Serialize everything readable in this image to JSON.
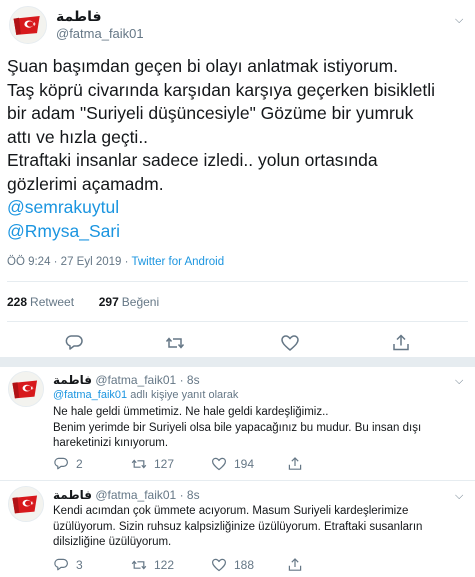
{
  "main_tweet": {
    "author_name": "فاطمة",
    "author_handle": "@fatma_faik01",
    "text_lines": [
      "Şuan başımdan geçen bi olayı anlatmak istiyorum.",
      "Taş köprü civarında karşıdan karşıya geçerken bisikletli",
      "bir adam \"Suriyeli düşüncesiyle\" Gözüme bir yumruk",
      "attı ve hızla geçti..",
      "Etraftaki insanlar sadece izledi.. yolun ortasında",
      "gözlerimi açamadm."
    ],
    "mentions": [
      "@semrakuytul",
      "@Rmysa_Sari"
    ],
    "time": "ÖÖ 9:24 · 27 Eyl 2019 · ",
    "source": "Twitter for Android",
    "retweets_count": "228",
    "retweets_label": "Retweet",
    "likes_count": "297",
    "likes_label": "Beğeni"
  },
  "replies": [
    {
      "author_name": "فاطمة",
      "author_handle": "@fatma_faik01 · 8s",
      "replying_to": "@fatma_faik01",
      "replying_suffix": " adlı kişiye yanıt olarak",
      "text_lines": [
        "Ne hale geldi ümmetimiz. Ne hale geldi kardeşliğimiz..",
        "Benim yerimde bir Suriyeli olsa bile yapacağınız bu mudur. Bu insan dışı",
        "hareketinizi kınıyorum."
      ],
      "reply_count": "2",
      "retweet_count": "127",
      "like_count": "194"
    },
    {
      "author_name": "فاطمة",
      "author_handle": "@fatma_faik01 · 8s",
      "text_lines": [
        "Kendi acımdan çok ümmete acıyorum. Masum Suriyeli kardeşlerimize",
        "üzülüyorum. Sizin ruhsuz kalpsizliğinize üzülüyorum. Etraftaki susanların",
        "dilsizliğine üzülüyorum."
      ],
      "reply_count": "3",
      "retweet_count": "122",
      "like_count": "188"
    }
  ],
  "icons": {
    "caret": "chevron-down-icon",
    "reply": "reply-icon",
    "retweet": "retweet-icon",
    "like": "heart-icon",
    "share": "share-icon",
    "avatar": "red-flag-avatar"
  },
  "colors": {
    "link": "#1b95e0",
    "secondary_text": "#657786",
    "divider": "#e6ecf0",
    "flag": "#d7191c"
  }
}
